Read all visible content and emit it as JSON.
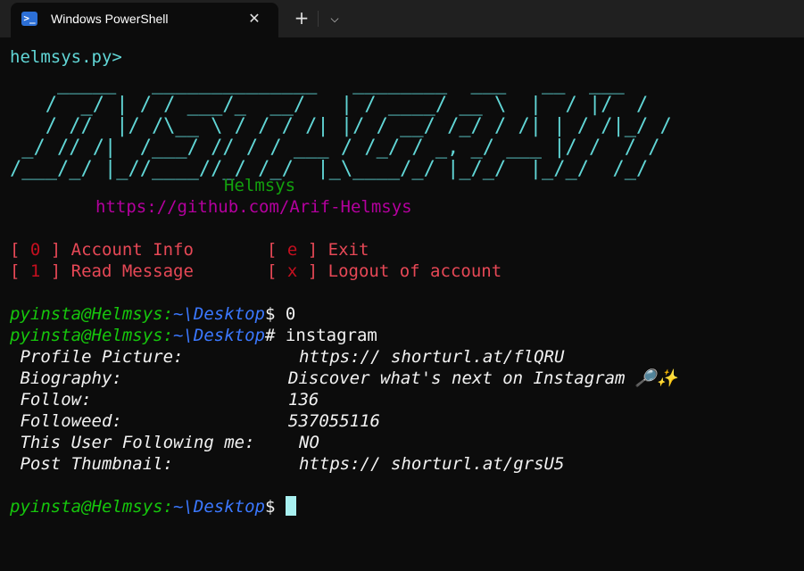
{
  "window": {
    "tab_title": "Windows PowerShell",
    "tab_icon": "powershell-icon",
    "close_icon": "close-icon",
    "new_tab_icon": "plus-icon",
    "dropdown_icon": "chevron-down-icon"
  },
  "terminal": {
    "script_prompt": "helmsys.py>",
    "banner": [
      "    _____   ______________   ________  ___   __  ___",
      "   /  _/ | / / ___/_  __/   | / ____/ __ \\  |  / |/  /",
      "   / //  |/ /\\__ \\ / / / /| |/ / __/ /_/ / /| | / /|_/ /",
      " _/ // /|  /___/ // / / ___ / /_/ / _, _/ ___ |/ /  / /",
      "/___/_/ |_//____//_/ /_/  |_\\____/_/ |_/_/  |_/_/  /_/"
    ],
    "author": "Helmsys",
    "url": "https://github.com/Arif-Helmsys",
    "menu": [
      {
        "key": "0",
        "label": "Account Info",
        "key2": "e",
        "label2": "Exit"
      },
      {
        "key": "1",
        "label": "Read Message",
        "key2": "x",
        "label2": "Logout of account"
      }
    ],
    "prompt_user": "pyinsta@Helmsys:",
    "prompt_path": "~\\Desktop",
    "command1_sym": "$",
    "command1": " 0",
    "command2_sym": "#",
    "command2": " instagram",
    "info": [
      {
        "label": " Profile Picture:",
        "value": "https:// shorturl.at/flQRU"
      },
      {
        "label": " Biography:",
        "value": "Discover what's next on Instagram 🔎✨"
      },
      {
        "label": " Follow:",
        "value": "136"
      },
      {
        "label": " Followeed:",
        "value": "537055116"
      },
      {
        "label": " This User Following me:",
        "value": "NO"
      },
      {
        "label": " Post Thumbnail:",
        "value": "https:// shorturl.at/grsU5"
      }
    ],
    "final_sym": "$"
  },
  "colors": {
    "background": "#0c0c0c",
    "titlebar": "#202020",
    "cyan": "#61d6d6",
    "green": "#13a10e",
    "magenta": "#b4009e",
    "red": "#e74856",
    "blue": "#3b78ff"
  }
}
